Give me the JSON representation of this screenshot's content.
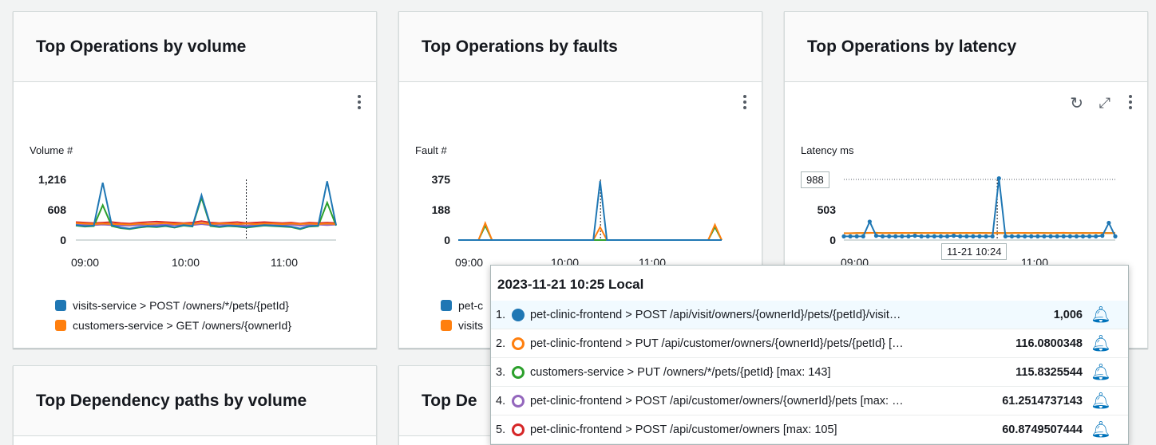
{
  "cards": {
    "volume": {
      "title": "Top Operations by volume",
      "unit": "Volume #",
      "yticks": [
        "1,216",
        "608",
        "0"
      ],
      "xticks": [
        "09:00",
        "10:00",
        "11:00"
      ],
      "legend": [
        {
          "label": "visits-service > POST /owners/*/pets/{petId}",
          "color": "#1f77b4"
        },
        {
          "label": "customers-service > GET /owners/{ownerId}",
          "color": "#ff7f0e"
        }
      ]
    },
    "faults": {
      "title": "Top Operations by faults",
      "unit": "Fault #",
      "yticks": [
        "375",
        "188",
        "0"
      ],
      "xticks": [
        "09:00",
        "10:00",
        "11:00"
      ],
      "legend": [
        {
          "label": "pet-c",
          "color": "#1f77b4"
        },
        {
          "label": "visits",
          "color": "#ff7f0e"
        }
      ]
    },
    "latency": {
      "title": "Top Operations by latency",
      "unit": "Latency ms",
      "yticks": [
        "988",
        "503",
        "0"
      ],
      "xticks": [
        "09:00",
        "10:00",
        "11:00"
      ],
      "hover_x": "11-21 10:24"
    },
    "dep_volume": {
      "title": "Top Dependency paths by volume"
    },
    "dep_faults": {
      "title": "Top De"
    }
  },
  "icons": {
    "refresh": "refresh-icon",
    "fullscreen": "fullscreen-icon",
    "more": "more-options-icon",
    "alarm": "bell-icon"
  },
  "tooltip": {
    "title": "2023-11-21 10:25 Local",
    "rows": [
      {
        "idx": "1.",
        "label": "pet-clinic-frontend > POST /api/visit/owners/{ownerId}/pets/{petId}/visit…",
        "value": "1,006",
        "color": "#1f77b4",
        "filled": true
      },
      {
        "idx": "2.",
        "label": "pet-clinic-frontend > PUT /api/customer/owners/{ownerId}/pets/{petId} […",
        "value": "116.0800348",
        "color": "#ff7f0e",
        "filled": false
      },
      {
        "idx": "3.",
        "label": "customers-service > PUT /owners/*/pets/{petId} [max: 143]",
        "value": "115.8325544",
        "color": "#2ca02c",
        "filled": false
      },
      {
        "idx": "4.",
        "label": "pet-clinic-frontend > POST /api/customer/owners/{ownerId}/pets [max: …",
        "value": "61.2514737143",
        "color": "#9467bd",
        "filled": false
      },
      {
        "idx": "5.",
        "label": "pet-clinic-frontend > POST /api/customer/owners [max: 105]",
        "value": "60.8749507444",
        "color": "#d62728",
        "filled": false
      }
    ]
  },
  "chart_data": [
    {
      "type": "line",
      "title": "Top Operations by volume",
      "ylabel": "Volume #",
      "ylim": [
        0,
        1216
      ],
      "x_range": [
        "08:40",
        "11:45"
      ],
      "xticks": [
        "09:00",
        "10:00",
        "11:00"
      ],
      "series": [
        {
          "name": "visits-service > POST /owners/*/pets/{petId}",
          "color": "#1f77b4",
          "values": [
            300,
            280,
            290,
            1150,
            300,
            250,
            230,
            260,
            280,
            270,
            290,
            260,
            300,
            280,
            900,
            300,
            270,
            290,
            280,
            260,
            280,
            300,
            290,
            280,
            270,
            230,
            280,
            290,
            1180,
            300
          ]
        },
        {
          "name": "customers-service > GET /owners/{ownerId}",
          "color": "#ff7f0e",
          "values": [
            340,
            330,
            320,
            330,
            320,
            320,
            310,
            330,
            320,
            330,
            340,
            320,
            330,
            320,
            340,
            320,
            330,
            330,
            320,
            330,
            320,
            330,
            330,
            320,
            330,
            320,
            330,
            320,
            330,
            320
          ]
        },
        {
          "color": "#2ca02c",
          "values": [
            290,
            270,
            280,
            700,
            280,
            240,
            220,
            250,
            270,
            260,
            280,
            250,
            290,
            270,
            850,
            280,
            260,
            280,
            270,
            250,
            270,
            290,
            280,
            270,
            260,
            220,
            270,
            280,
            750,
            290
          ]
        },
        {
          "color": "#d62728",
          "values": [
            360,
            350,
            340,
            350,
            360,
            340,
            330,
            350,
            360,
            370,
            360,
            350,
            340,
            350,
            380,
            350,
            340,
            350,
            360,
            340,
            350,
            360,
            350,
            340,
            350,
            330,
            350,
            340,
            350,
            340
          ]
        },
        {
          "color": "#9467bd",
          "values": [
            320,
            310,
            300,
            310,
            300,
            290,
            290,
            300,
            310,
            300,
            310,
            300,
            310,
            300,
            320,
            300,
            310,
            300,
            300,
            290,
            300,
            310,
            300,
            300,
            310,
            290,
            300,
            310,
            300,
            310
          ]
        }
      ]
    },
    {
      "type": "line",
      "title": "Top Operations by faults",
      "ylabel": "Fault #",
      "ylim": [
        0,
        375
      ],
      "x_range": [
        "08:40",
        "11:45"
      ],
      "xticks": [
        "09:00",
        "10:00",
        "11:00"
      ],
      "series": [
        {
          "color": "#1f77b4",
          "values": [
            0,
            0,
            0,
            0,
            0,
            0,
            0,
            0,
            0,
            0,
            0,
            0,
            0,
            0,
            0,
            0,
            0,
            0,
            0,
            0,
            0,
            365,
            0,
            0,
            0,
            0,
            0,
            0,
            0,
            0,
            0,
            0,
            0,
            0,
            0,
            0,
            0,
            0,
            0,
            0
          ]
        },
        {
          "color": "#ff7f0e",
          "values": [
            0,
            0,
            0,
            0,
            105,
            0,
            0,
            0,
            0,
            0,
            0,
            0,
            0,
            0,
            0,
            0,
            0,
            0,
            0,
            0,
            0,
            80,
            0,
            0,
            0,
            0,
            0,
            0,
            0,
            0,
            0,
            0,
            0,
            0,
            0,
            0,
            0,
            0,
            95,
            0
          ]
        },
        {
          "color": "#2ca02c",
          "values": [
            0,
            0,
            0,
            0,
            90,
            0,
            0,
            0,
            0,
            0,
            0,
            0,
            0,
            0,
            0,
            0,
            0,
            0,
            0,
            0,
            0,
            0,
            0,
            0,
            0,
            0,
            0,
            0,
            0,
            0,
            0,
            0,
            0,
            0,
            0,
            0,
            0,
            0,
            80,
            0
          ]
        },
        {
          "color": "#9467bd",
          "values": [
            0,
            0,
            0,
            0,
            0,
            0,
            0,
            0,
            0,
            0,
            0,
            0,
            0,
            0,
            0,
            0,
            0,
            0,
            0,
            0,
            0,
            0,
            0,
            0,
            0,
            0,
            0,
            0,
            0,
            0,
            0,
            0,
            0,
            0,
            0,
            0,
            0,
            0,
            0,
            0
          ]
        }
      ]
    },
    {
      "type": "line",
      "title": "Top Operations by latency",
      "ylabel": "Latency ms",
      "ylim": [
        0,
        988
      ],
      "x_range": [
        "08:40",
        "11:45"
      ],
      "xticks": [
        "09:00",
        "10:00",
        "11:00"
      ],
      "series": [
        {
          "color": "#1f77b4",
          "values": [
            60,
            60,
            60,
            60,
            300,
            70,
            60,
            60,
            60,
            60,
            60,
            70,
            60,
            60,
            60,
            60,
            60,
            70,
            60,
            60,
            60,
            60,
            60,
            60,
            1006,
            60,
            60,
            60,
            60,
            60,
            60,
            60,
            60,
            60,
            60,
            60,
            60,
            60,
            60,
            60,
            70,
            280,
            60
          ]
        },
        {
          "color": "#ff7f0e",
          "values": [
            110,
            112,
            115,
            116,
            118,
            116,
            114,
            116,
            115,
            117,
            116,
            114,
            115,
            116,
            118,
            115,
            114,
            116,
            115,
            117,
            116,
            114,
            116,
            115,
            116,
            115,
            114,
            116,
            117,
            115,
            116,
            114,
            115,
            116,
            118,
            115,
            114,
            116,
            115,
            117,
            116,
            114,
            115
          ]
        },
        {
          "color": "#2ca02c",
          "values": [
            112,
            110,
            113,
            115,
            116,
            118,
            115,
            113,
            116,
            114,
            115,
            117,
            116,
            114,
            115,
            116,
            113,
            115,
            116,
            114,
            115,
            117,
            116,
            113,
            116,
            114,
            115,
            116,
            114,
            115,
            117,
            116,
            113,
            115,
            116,
            114,
            115,
            116,
            114,
            115,
            116,
            113,
            115
          ]
        }
      ]
    }
  ]
}
